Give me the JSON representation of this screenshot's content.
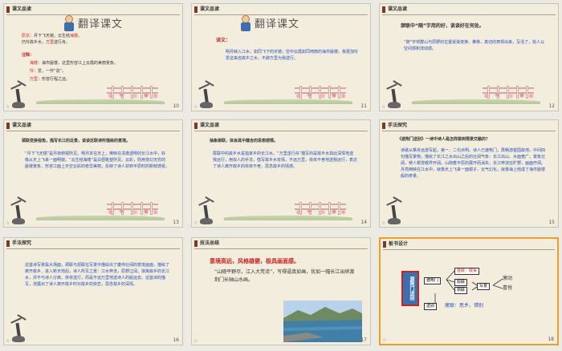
{
  "slides": [
    {
      "num": "10",
      "header": "课文品读",
      "title": "翻译课文",
      "l1a": "原文：",
      "l1b": "月下飞天镜，云生结",
      "l1c": "海楼",
      "l1d": "。",
      "l2a": "仍怜故乡水，",
      "l2b": "万里",
      "l2c": "送行舟。",
      "note": "注释：",
      "n1a": "海楼：",
      "n1b": "海市蜃楼，这里形容江上云霞的美丽景象。",
      "n2a": "怜：",
      "n2b": "爱，一作“造”。",
      "n3a": "万里：",
      "n3b": "形容行程之远。"
    },
    {
      "num": "11",
      "header": "课文品读",
      "title": "翻译课文",
      "label": "译文：",
      "text": "明月映入江水，如同飞下的天镜；空中云霞如同绮丽的海市蜃楼。我更加怜爱这来自故乡之水，不辞万里为我送行。"
    },
    {
      "num": "12",
      "header": "课文品读",
      "q1": "颔联中“随”字用的好，谈谈好在何处。",
      "a1": "“随”字将群山与原野的位置逐渐变换、推移，真切的表现出来，写活了，给人以空间感和流动感。"
    },
    {
      "num": "13",
      "header": "课文品读",
      "q1": "颈联变换视角，描写长江的近景，谈谈这联诗所描绘的意境。",
      "a1": "“月下飞天镜”是月夜俯视所见。明月本在天上，倒映在清澈透明的长江水中，好像从天上飞来一面明镜。“云生结海楼”是白昼眺望所见。云彩，则用变幻无穷的蜃楼景象，形容江面上天空云彩的奇异美丽，反映了诗人初到平原时的新鲜感受。"
    },
    {
      "num": "14",
      "header": "课文品读",
      "q1": "抽象阐联，体会其中蕴含的思想感情。",
      "a1": "尾联中的故乡水是指家乡的长江水。“万里送行舟”描写的是故乡水如此深情地送我远行，用拟人的手法，借写故乡水有情，不远万里，依依不舍地送我远行，表达了诗人离开故乡的依依不舍，思念故乡的情感。"
    },
    {
      "num": "15",
      "header": "手法探究",
      "q1": "《渡荆门送别》一诗中诗人是怎样做到情景交融的？",
      "a1": "诗歌从乘舟远游写起，第一、二句点明，诗人已渡荆门，再畅游楚国故地。中间四句描写景物，描绘了长江之水出山之后的壮阔气象：长江出山、水面宽广，景象壮阔，使人顿觉眼界开阔。山随着平原的展开而消失，长江奔流在旷野，画面开阔。月亮倒映在江水中，就像天上飞来一面镜子，云气幻化，就像海上结成了海市蜃楼般的奇景。"
    },
    {
      "num": "16",
      "header": "手法探究",
      "a1": "这首诗写景属大场面，颈联与颔联在写景中描绘出了雄伟壮阔的意境画面，描绘了离开故乡、进入新天地后，诗人所见之景：江水奔流，原野辽阔，渐离故乡的长江水，并不与诗人分离，依依送行，而是不远万里地送诗人的船远去。这首诗的描写，流露出了诗人离开故乡时对故乡的依恋，思念故乡的深情。"
    },
    {
      "num": "17",
      "header": "技法总结",
      "t1": "意境高远，风格雄健，极具画面感。",
      "t2": "“山随平野尽，江入大荒流”，写得逼真如画，犹如一幅长江出峡渡荆门长轴山水画。"
    },
    {
      "num": "18",
      "header": "板书设计",
      "main": "渡荆门送别",
      "node1": "渡荆门",
      "node2": "送别",
      "b1": "首联：叙事",
      "b2": "颔联",
      "b3": "颈联",
      "b4": "写景",
      "b5": "激动",
      "b6": "喜悦",
      "b7": "尾联：思乡，惜别"
    }
  ],
  "colors": {
    "selected_border": "#f0a020",
    "header_bar": "#7a3b2a",
    "red": "#d02020",
    "blue": "#2050c0"
  }
}
